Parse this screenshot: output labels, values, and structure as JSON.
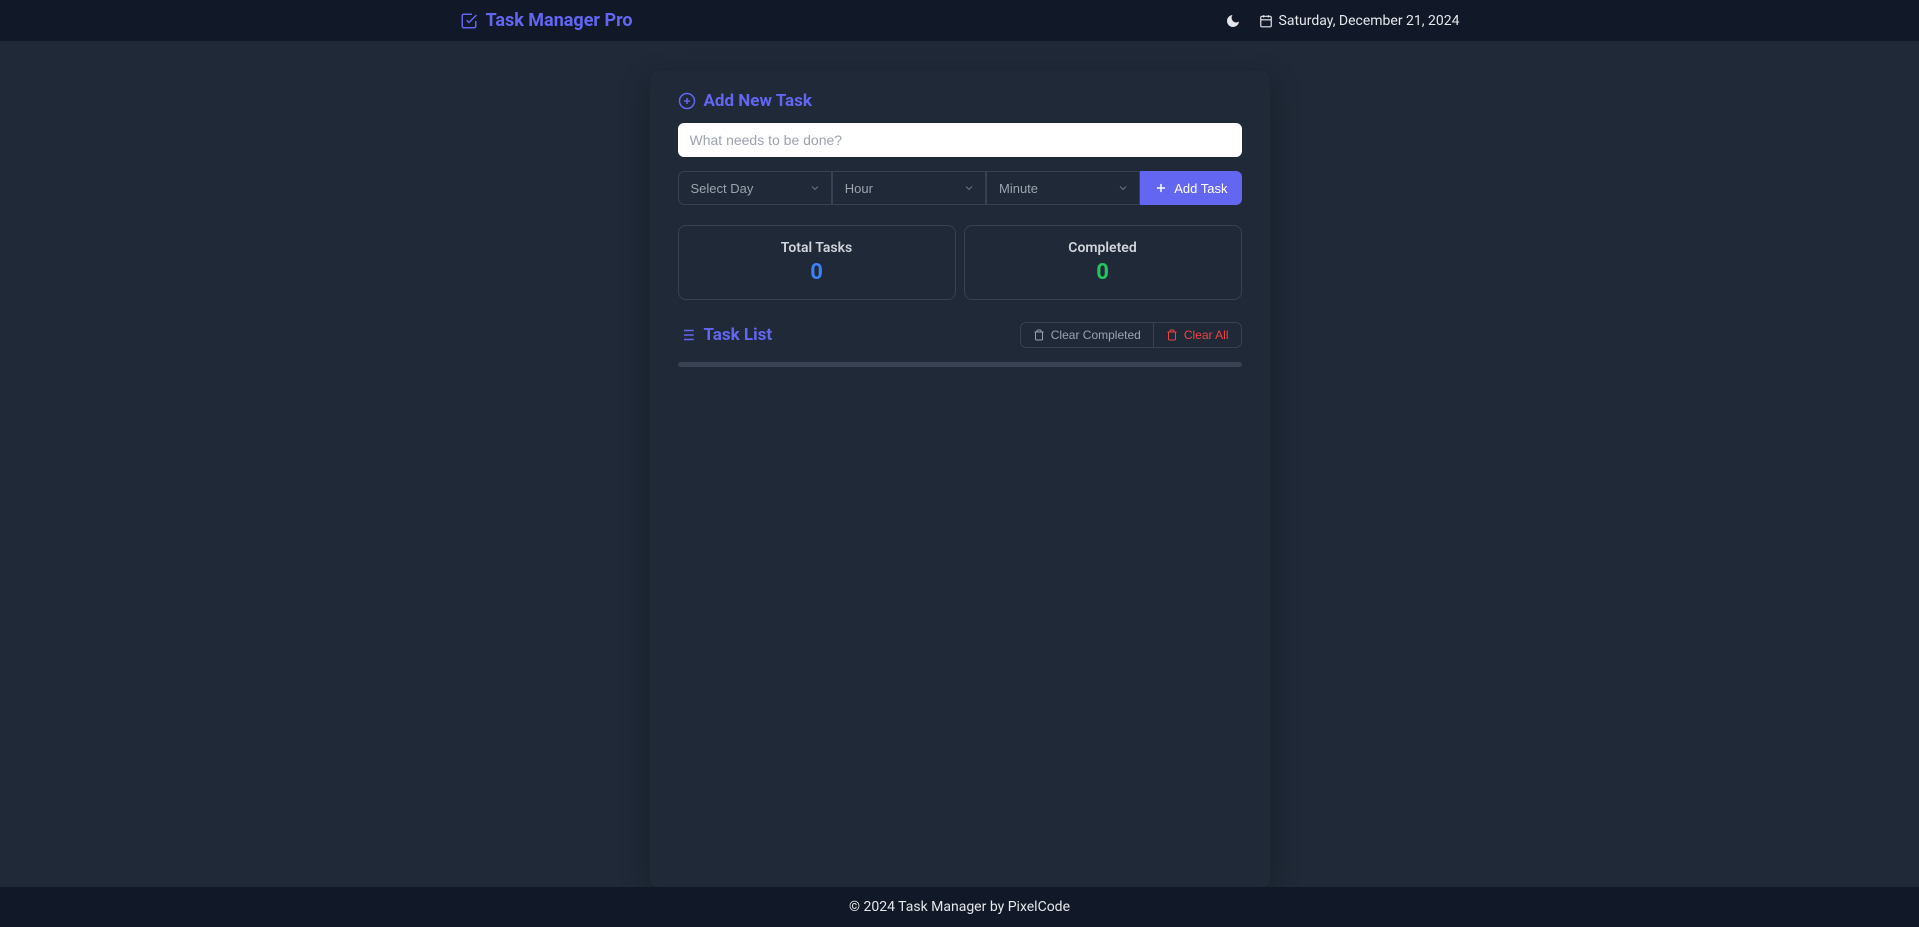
{
  "header": {
    "title": "Task Manager Pro",
    "date": "Saturday, December 21, 2024"
  },
  "addSection": {
    "title": "Add New Task",
    "placeholder": "What needs to be done?",
    "daySelect": "Select Day",
    "hourSelect": "Hour",
    "minuteSelect": "Minute",
    "addButton": "Add Task"
  },
  "stats": {
    "totalLabel": "Total Tasks",
    "totalValue": "0",
    "completedLabel": "Completed",
    "completedValue": "0"
  },
  "listSection": {
    "title": "Task List",
    "clearCompleted": "Clear Completed",
    "clearAll": "Clear All"
  },
  "footer": {
    "text": "© 2024 Task Manager by PixelCode"
  }
}
